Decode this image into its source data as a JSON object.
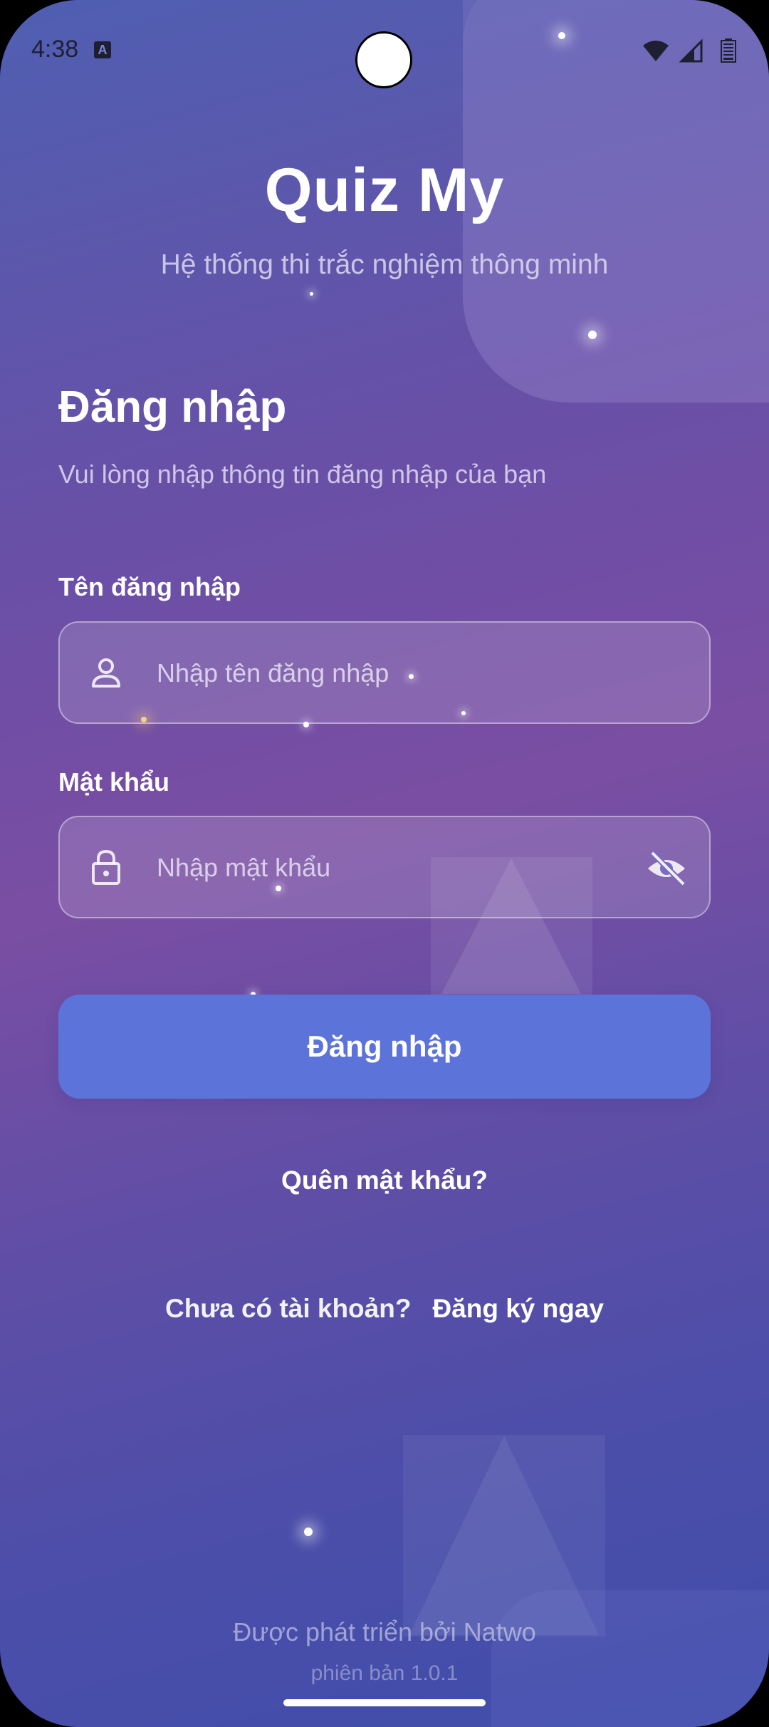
{
  "status_bar": {
    "time": "4:38",
    "notification_icon": "a-icon",
    "icons": [
      "wifi-icon",
      "signal-icon",
      "battery-icon"
    ]
  },
  "header": {
    "title": "Quiz My",
    "subtitle": "Hệ thống thi trắc nghiệm thông minh"
  },
  "form": {
    "heading": "Đăng nhập",
    "description": "Vui lòng nhập thông tin đăng nhập của bạn",
    "username": {
      "label": "Tên đăng nhập",
      "placeholder": "Nhập tên đăng nhập",
      "value": "",
      "icon": "person-icon"
    },
    "password": {
      "label": "Mật khẩu",
      "placeholder": "Nhập mật khẩu",
      "value": "",
      "icon": "lock-icon",
      "toggle_icon": "eye-off-icon"
    },
    "submit_label": "Đăng nhập",
    "forgot_label": "Quên mật khẩu?"
  },
  "signup": {
    "question": "Chưa có tài khoản?",
    "link": "Đăng ký ngay"
  },
  "footer": {
    "developer": "Được phát triển bởi Natwo",
    "version": "phiên bản 1.0.1"
  },
  "colors": {
    "background_top": "#4f5fb2",
    "background_mid": "#7a4ea3",
    "background_bottom": "#3f4eab",
    "button": "#5c74da",
    "text": "#ffffff"
  }
}
